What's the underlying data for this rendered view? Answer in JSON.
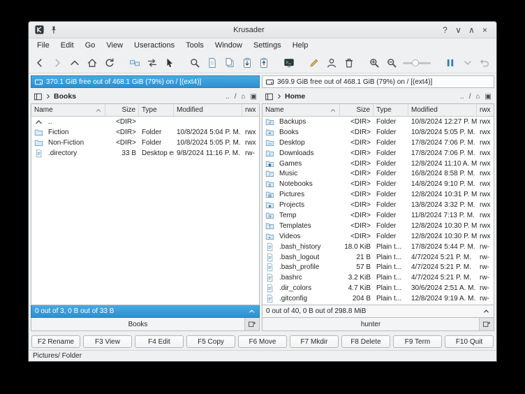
{
  "window": {
    "title": "Krusader",
    "controls": [
      {
        "name": "help-button",
        "glyph": "?"
      },
      {
        "name": "minimize-button",
        "glyph": "∨"
      },
      {
        "name": "maximize-button",
        "glyph": "∧"
      },
      {
        "name": "close-button",
        "glyph": "×"
      }
    ]
  },
  "menu": {
    "items": [
      "File",
      "Edit",
      "Go",
      "View",
      "Useractions",
      "Tools",
      "Window",
      "Settings",
      "Help"
    ]
  },
  "toolbar": {
    "items": [
      {
        "name": "back-button",
        "icon": "arrow-left"
      },
      {
        "name": "forward-button",
        "icon": "arrow-right",
        "disabled": true
      },
      {
        "name": "up-button",
        "icon": "arrow-up"
      },
      {
        "name": "home-button",
        "icon": "home"
      },
      {
        "name": "reload-button",
        "icon": "reload"
      },
      {
        "sep": true
      },
      {
        "name": "equal-panels-button",
        "icon": "compare-dirs"
      },
      {
        "name": "swap-panels-button",
        "icon": "swap-panels"
      },
      {
        "name": "start-program-button",
        "icon": "pointer"
      },
      {
        "sep": true
      },
      {
        "name": "find-button",
        "icon": "find"
      },
      {
        "name": "new-file-button",
        "icon": "doc"
      },
      {
        "name": "copy-button",
        "icon": "doc-copy"
      },
      {
        "name": "paste-button",
        "icon": "clipboard-down"
      },
      {
        "name": "copy-to-clipboard-button",
        "icon": "clipboard-up"
      },
      {
        "sep": true
      },
      {
        "name": "terminal-button",
        "icon": "terminal"
      },
      {
        "sep": true
      },
      {
        "name": "rename-button",
        "icon": "pencil"
      },
      {
        "name": "root-mode-button",
        "icon": "user"
      },
      {
        "name": "delete-button",
        "icon": "trash"
      },
      {
        "sep": true
      },
      {
        "name": "zoom-in-button",
        "icon": "zoom-in"
      },
      {
        "name": "zoom-out-button",
        "icon": "zoom-out"
      },
      {
        "slider": true,
        "name": "icon-size-slider"
      },
      {
        "sep": true
      },
      {
        "name": "jobs-pause-button",
        "icon": "pause"
      },
      {
        "name": "jobs-menu-button",
        "icon": "chevron-down-small",
        "disabled": true
      },
      {
        "name": "undo-button",
        "icon": "undo",
        "disabled": true
      }
    ]
  },
  "columns": [
    "Name",
    "Size",
    "Type",
    "Modified",
    "rwx"
  ],
  "crumb_buttons": [
    {
      "name": "parent-dir-button",
      "glyph": ".."
    },
    {
      "name": "root-dir-button",
      "glyph": "/"
    },
    {
      "name": "home-dir-button",
      "glyph": "⌂"
    },
    {
      "name": "popup-panel-button",
      "glyph": "▣"
    }
  ],
  "left_panel": {
    "active": true,
    "info": "370.1 GiB free out of 468.1 GiB (79%) on / [(ext4)]",
    "breadcrumb": "Books",
    "rows": [
      {
        "icon": "up-dir",
        "name": "..",
        "size": "<DIR>",
        "type": "",
        "modified": "",
        "perm": ""
      },
      {
        "icon": "folder",
        "name": "Fiction",
        "size": "<DIR>",
        "type": "Folder",
        "modified": "10/8/2024 5:04 P. M.",
        "perm": "rwx"
      },
      {
        "icon": "folder",
        "name": "Non-Fiction",
        "size": "<DIR>",
        "type": "Folder",
        "modified": "10/8/2024 5:05 P. M.",
        "perm": "rwx"
      },
      {
        "icon": "file",
        "name": ".directory",
        "size": "33 B",
        "type": "Desktop en...",
        "modified": "9/8/2024 11:16 P. M.",
        "perm": "rw-"
      }
    ],
    "status": "0 out of 3, 0 B out of 33 B",
    "tab": "Books"
  },
  "right_panel": {
    "active": false,
    "info": "369.9 GiB free out of 468.1 GiB (79%) on / [(ext4)]",
    "breadcrumb": "Home",
    "rows": [
      {
        "icon": "folder-backups",
        "name": "Backups",
        "size": "<DIR>",
        "type": "Folder",
        "modified": "10/8/2024 12:27 P. M.",
        "perm": "rwx"
      },
      {
        "icon": "folder-books",
        "name": "Books",
        "size": "<DIR>",
        "type": "Folder",
        "modified": "10/8/2024 5:05 P. M.",
        "perm": "rwx"
      },
      {
        "icon": "folder-desktop",
        "name": "Desktop",
        "size": "<DIR>",
        "type": "Folder",
        "modified": "17/8/2024 7:06 P. M.",
        "perm": "rwx"
      },
      {
        "icon": "folder-downloads",
        "name": "Downloads",
        "size": "<DIR>",
        "type": "Folder",
        "modified": "17/8/2024 7:06 P. M.",
        "perm": "rwx"
      },
      {
        "icon": "folder-games",
        "name": "Games",
        "size": "<DIR>",
        "type": "Folder",
        "modified": "12/8/2024 11:10 A. M.",
        "perm": "rwx"
      },
      {
        "icon": "folder-music",
        "name": "Music",
        "size": "<DIR>",
        "type": "Folder",
        "modified": "16/8/2024 8:58 P. M.",
        "perm": "rwx"
      },
      {
        "icon": "folder-notebooks",
        "name": "Notebooks",
        "size": "<DIR>",
        "type": "Folder",
        "modified": "14/8/2024 9:10 P. M.",
        "perm": "rwx"
      },
      {
        "icon": "folder-pictures",
        "name": "Pictures",
        "size": "<DIR>",
        "type": "Folder",
        "modified": "12/8/2024 10:31 P. M.",
        "perm": "rwx"
      },
      {
        "icon": "folder-projects",
        "name": "Projects",
        "size": "<DIR>",
        "type": "Folder",
        "modified": "13/8/2024 3:32 P. M.",
        "perm": "rwx"
      },
      {
        "icon": "folder-temp",
        "name": "Temp",
        "size": "<DIR>",
        "type": "Folder",
        "modified": "11/8/2024 7:13 P. M.",
        "perm": "rwx"
      },
      {
        "icon": "folder-templates",
        "name": "Templates",
        "size": "<DIR>",
        "type": "Folder",
        "modified": "12/8/2024 10:30 P. M.",
        "perm": "rwx"
      },
      {
        "icon": "folder-videos",
        "name": "Videos",
        "size": "<DIR>",
        "type": "Folder",
        "modified": "12/8/2024 10:30 P. M.",
        "perm": "rwx"
      },
      {
        "icon": "file",
        "name": ".bash_history",
        "size": "18.0 KiB",
        "type": "Plain t...",
        "modified": "17/8/2024 5:44 P. M.",
        "perm": "rw-"
      },
      {
        "icon": "file",
        "name": ".bash_logout",
        "size": "21 B",
        "type": "Plain t...",
        "modified": "4/7/2024 5:21 P. M.",
        "perm": "rw-"
      },
      {
        "icon": "file",
        "name": ".bash_profile",
        "size": "57 B",
        "type": "Plain t...",
        "modified": "4/7/2024 5:21 P. M.",
        "perm": "rw-"
      },
      {
        "icon": "file",
        "name": ".bashrc",
        "size": "3.2 KiB",
        "type": "Plain t...",
        "modified": "4/7/2024 5:21 P. M.",
        "perm": "rw-"
      },
      {
        "icon": "file",
        "name": ".dir_colors",
        "size": "4.7 KiB",
        "type": "Plain t...",
        "modified": "30/6/2024 2:51 A. M.",
        "perm": "rw-"
      },
      {
        "icon": "file",
        "name": ".gitconfig",
        "size": "204 B",
        "type": "Plain t...",
        "modified": "12/8/2024 9:19 A. M.",
        "perm": "rw-"
      }
    ],
    "status": "0 out of 40, 0 B out of 298.8 MiB",
    "tab": "hunter"
  },
  "fkeys": [
    "F2 Rename",
    "F3 View",
    "F4 Edit",
    "F5 Copy",
    "F6 Move",
    "F7 Mkdir",
    "F8 Delete",
    "F9 Term",
    "F10 Quit"
  ],
  "statusbar": {
    "text": "Pictures/ Folder"
  }
}
